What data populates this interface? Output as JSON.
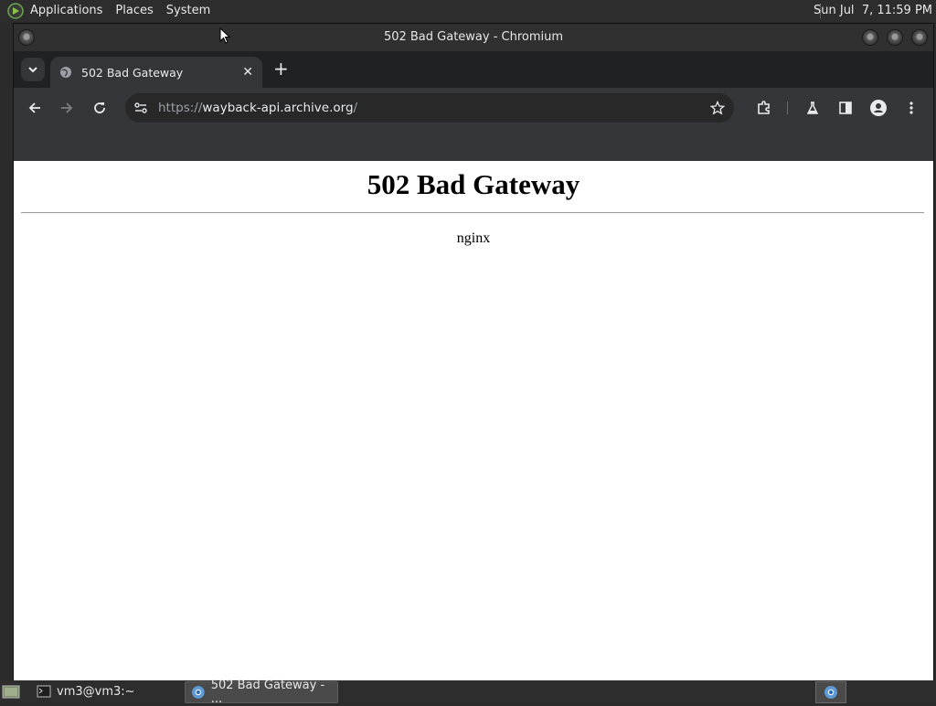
{
  "top_panel": {
    "menus": [
      "Applications",
      "Places",
      "System"
    ],
    "clock": "Sun Jul  7, 11:59 PM"
  },
  "window": {
    "title": "502 Bad Gateway - Chromium"
  },
  "browser": {
    "tab": {
      "title": "502 Bad Gateway"
    },
    "address": {
      "scheme": "https://",
      "host": "wayback-api.archive.org",
      "path": "/"
    }
  },
  "page": {
    "heading": "502 Bad Gateway",
    "server": "nginx"
  },
  "taskbar": {
    "tasks": [
      {
        "label": "vm3@vm3:~"
      },
      {
        "label": "502 Bad Gateway - ..."
      }
    ]
  },
  "colors": {
    "panel": "#2d2d2d",
    "browser_chrome": "#35363a",
    "page_background": "#ffffff"
  }
}
